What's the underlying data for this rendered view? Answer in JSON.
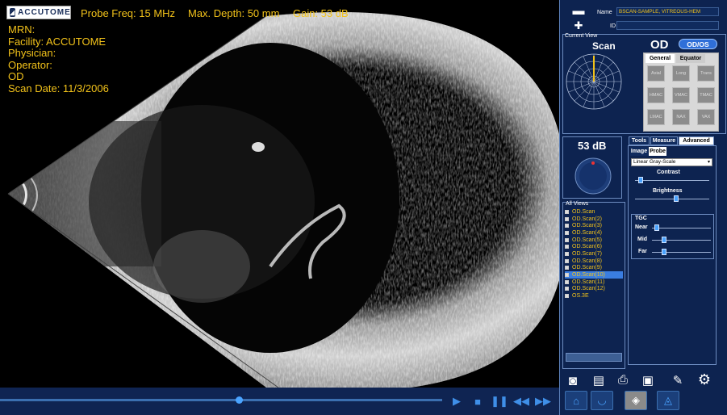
{
  "header": {
    "logo": "ACCUTOME",
    "probe_freq": "Probe Freq: 15 MHz",
    "max_depth": "Max. Depth: 50 mm",
    "gain": "Gain: 53 dB"
  },
  "patient_info": {
    "mrn": "MRN:",
    "facility": "Facility: ACCUTOME",
    "physician": "Physician:",
    "operator": "Operator:",
    "eye": "OD",
    "scan_date": "Scan Date: 11/3/2006"
  },
  "panel": {
    "name_label": "Name",
    "name_value": "BSCAN-SAMPLE, VITREOUS-HEM",
    "id_label": "ID",
    "id_value": "",
    "current_view_label": "Current View",
    "view_name": "Scan",
    "eye": "OD",
    "eye_toggle": "OD/OS",
    "view_tabs": [
      "General",
      "Equator"
    ],
    "mode_buttons": [
      "Axial",
      "Long",
      "Trans",
      "HMAC",
      "VMAC",
      "TMAC",
      "LMAC",
      "NAX",
      "VAX"
    ],
    "gain_value": "53 dB",
    "tool_tabs": [
      "Tools",
      "Measure",
      "Advanced"
    ],
    "sub_tabs": [
      "Image",
      "Probe"
    ],
    "colormap": "Linear Gray-Scale",
    "contrast_label": "Contrast",
    "brightness_label": "Brightness",
    "contrast_level": 0.08,
    "brightness_level": 0.55,
    "tgc_label": "TGC",
    "tgc": [
      {
        "label": "Near",
        "level": 0.08
      },
      {
        "label": "Mid",
        "level": 0.2
      },
      {
        "label": "Far",
        "level": 0.2
      }
    ],
    "all_views_label": "All Views",
    "views": [
      "OD.Scan",
      "OD.Scan(2)",
      "OD.Scan(3)",
      "OD.Scan(4)",
      "OD.Scan(5)",
      "OD.Scan(6)",
      "OD.Scan(7)",
      "OD.Scan(8)",
      "OD.Scan(9)",
      "OD.Scan(10)",
      "OD.Scan(11)",
      "OD.Scan(12)",
      "OS.3E"
    ],
    "selected_view": 9
  },
  "playback": {
    "position": 0.54
  },
  "icons": [
    "folder-icon",
    "add-patient-icon",
    "camera-icon",
    "document-icon",
    "print-icon",
    "save-icon",
    "pencil-icon",
    "gear-icon",
    "home-icon"
  ],
  "colors": {
    "accent_yellow": "#f2c21a",
    "panel_bg": "#0d2350",
    "accent_blue": "#3a7de0"
  }
}
